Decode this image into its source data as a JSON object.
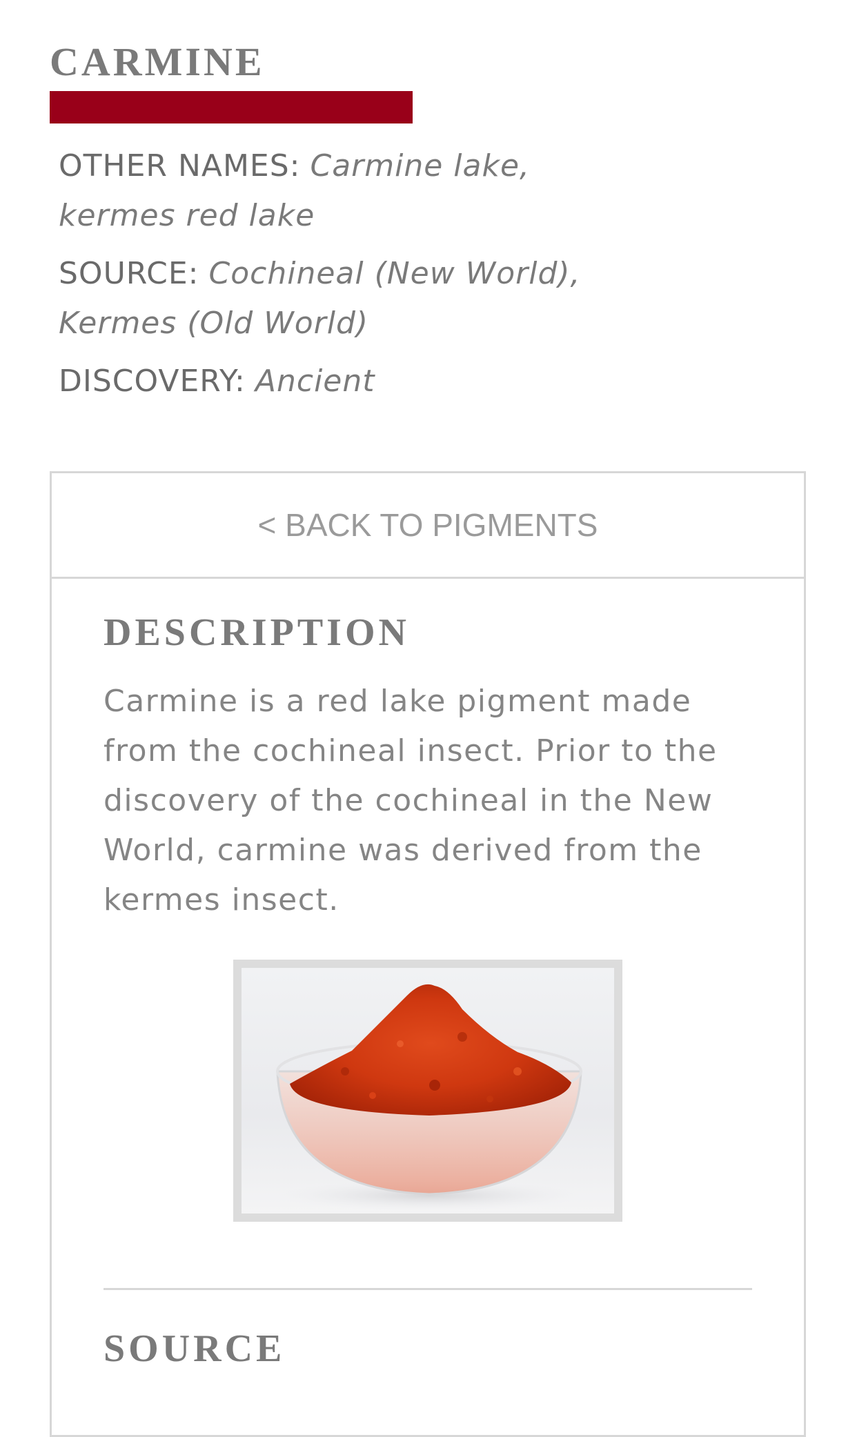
{
  "pigment": {
    "name": "CARMINE",
    "swatch_color": "#990019"
  },
  "meta": {
    "other_names_label": "OTHER NAMES:",
    "other_names_value_line1": "Carmine lake,",
    "other_names_value_line2": "kermes red lake",
    "source_label": "SOURCE:",
    "source_value_line1": "Cochineal (New World),",
    "source_value_line2": "Kermes (Old World)",
    "discovery_label": "DISCOVERY:",
    "discovery_value": "Ancient"
  },
  "panel": {
    "back_label": "< BACK TO PIGMENTS",
    "description_heading": "DESCRIPTION",
    "description_text": "Carmine is a red lake pigment made from the cochineal insect. Prior to the discovery of the cochineal in the New World, carmine was derived from the kermes insect.",
    "source_heading": "SOURCE"
  },
  "colors": {
    "accent": "#990019",
    "border": "#d7d7d7",
    "text": "#6f6f6f"
  }
}
